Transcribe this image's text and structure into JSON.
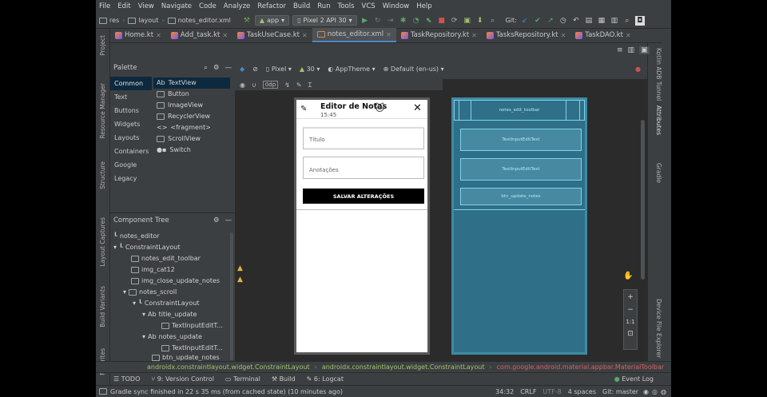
{
  "menu": [
    "File",
    "Edit",
    "View",
    "Navigate",
    "Code",
    "Analyze",
    "Refactor",
    "Build",
    "Run",
    "Tools",
    "VCS",
    "Window",
    "Help"
  ],
  "nav": {
    "crumbs": [
      "res",
      "layout",
      "notes_editor.xml"
    ],
    "run_config": "app",
    "device": "Pixel 2 API 30",
    "git_label": "Git:"
  },
  "tabs": [
    "Home.kt",
    "Add_task.kt",
    "TaskUseCase.kt",
    "notes_editor.xml",
    "TaskRepository.kt",
    "TasksRepository.kt",
    "TaskDAO.kt"
  ],
  "left_strip": [
    "Project",
    "Resource Manager",
    "Structure",
    "Layout Captures",
    "Build Variants",
    "Favorites"
  ],
  "right_strip": [
    "Kotlin ADB Tunnel",
    "Attributes",
    "Gradle",
    "Device File Explorer"
  ],
  "design_toolbar": {
    "device": "Pixel",
    "api": "30",
    "theme": "AppTheme",
    "locale": "Default (en-us)",
    "margin": "0dp"
  },
  "palette": {
    "title": "Palette",
    "categories": [
      "Common",
      "Text",
      "Buttons",
      "Widgets",
      "Layouts",
      "Containers",
      "Google",
      "Legacy"
    ],
    "items": [
      {
        "prefix": "Ab",
        "label": "TextView"
      },
      {
        "prefix": "",
        "label": "Button"
      },
      {
        "prefix": "",
        "label": "ImageView"
      },
      {
        "prefix": "",
        "label": "RecyclerView"
      },
      {
        "prefix": "<>",
        "label": "<fragment>"
      },
      {
        "prefix": "",
        "label": "ScrollView"
      },
      {
        "prefix": "",
        "label": "Switch"
      }
    ]
  },
  "tree": {
    "title": "Component Tree",
    "rows": [
      "notes_editor",
      "ConstraintLayout",
      "notes_edit_toolbar",
      "img_cat12",
      "img_close_update_notes",
      "notes_scroll",
      "ConstraintLayout",
      "title_update",
      "TextInputEditT...",
      "notes_update",
      "TextInputEditT...",
      "btn_update_notes"
    ]
  },
  "phone": {
    "title": "Editor de Notas",
    "time": "15:45",
    "field1": "Título",
    "field2": "Anotações",
    "button": "SALVAR ALTERAÇÕES"
  },
  "blueprint": {
    "toolbar": "notes_edit_toolbar",
    "box1": "TextInputEditText",
    "box2": "TextInputEditText",
    "box3": "btn_update_notes"
  },
  "breadcrumb_path": [
    "androidx.constraintlayout.widget.ConstraintLayout",
    "androidx.constraintlayout.widget.ConstraintLayout",
    "com.google.android.material.appbar.MaterialToolbar"
  ],
  "bottom_tools": [
    "TODO",
    "9: Version Control",
    "Terminal",
    "Build",
    "6: Logcat"
  ],
  "event_log": "Event Log",
  "statusbar": {
    "message": "Gradle sync finished in 22 s 35 ms (from cached state) (10 minutes ago)",
    "position": "34:32",
    "line_sep": "CRLF",
    "encoding": "UTF-8",
    "indent": "4 spaces",
    "branch": "Git: master"
  },
  "zoom": [
    "+",
    "−",
    "1:1"
  ],
  "colors": {
    "accent": "#4a88c7",
    "path_green": "#9fc36b",
    "path_red": "#d65f5f"
  }
}
